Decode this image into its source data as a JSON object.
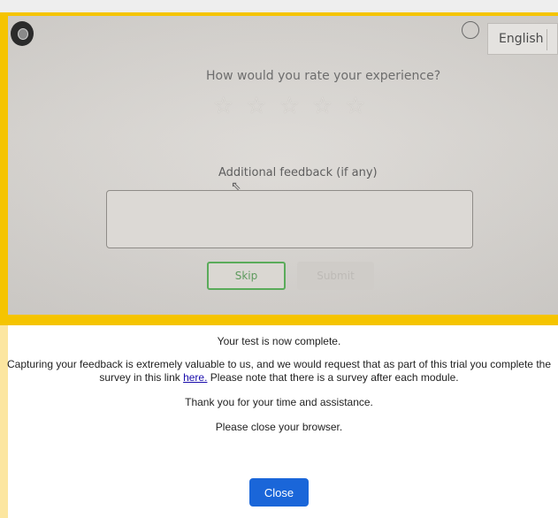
{
  "survey_screenshot": {
    "language": "English",
    "rating_question": "How would you rate your experience?",
    "star_icons": [
      "star-outline-icon",
      "star-outline-icon",
      "star-outline-icon",
      "star-outline-icon",
      "star-outline-icon"
    ],
    "feedback_label": "Additional feedback (if any)",
    "feedback_value": "",
    "skip_label": "Skip",
    "submit_label": "Submit"
  },
  "completion": {
    "heading": "Your test is now complete.",
    "paragraph_before_link": "Capturing your feedback is extremely valuable to us, and we would request that as part of this trial you complete the survey in this link ",
    "link_text": "here.",
    "paragraph_after_link": " Please note that there is a survey after each module.",
    "thanks": "Thank you for your time and assistance.",
    "close_instruction": "Please close your browser.",
    "close_button": "Close"
  },
  "colors": {
    "frame": "#f5c400",
    "close_button": "#1a66d9",
    "skip_border": "#5aab5a",
    "link": "#1a0dab"
  }
}
